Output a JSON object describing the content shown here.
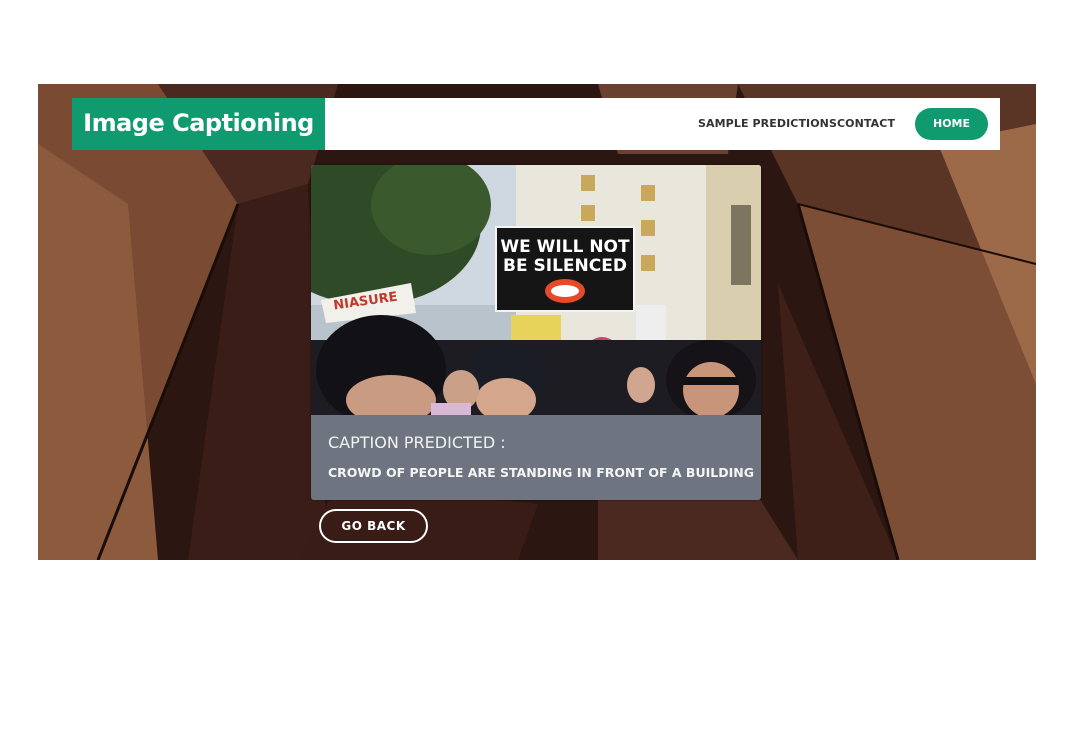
{
  "brand": {
    "title": "Image Captioning"
  },
  "nav": {
    "links": [
      "SAMPLE PREDICTIONS",
      "CONTACT"
    ],
    "home_label": "HOME"
  },
  "photo": {
    "sign_line1": "WE WILL NOT",
    "sign_line2": "BE SILENCED",
    "left_sign": "NIASURE"
  },
  "result": {
    "heading": "CAPTION PREDICTED :",
    "caption": "CROWD OF PEOPLE ARE STANDING IN FRONT OF A BUILDING"
  },
  "actions": {
    "back_label": "GO BACK"
  },
  "colors": {
    "accent": "#0f9a6f",
    "caption_panel": "#6e7480"
  }
}
